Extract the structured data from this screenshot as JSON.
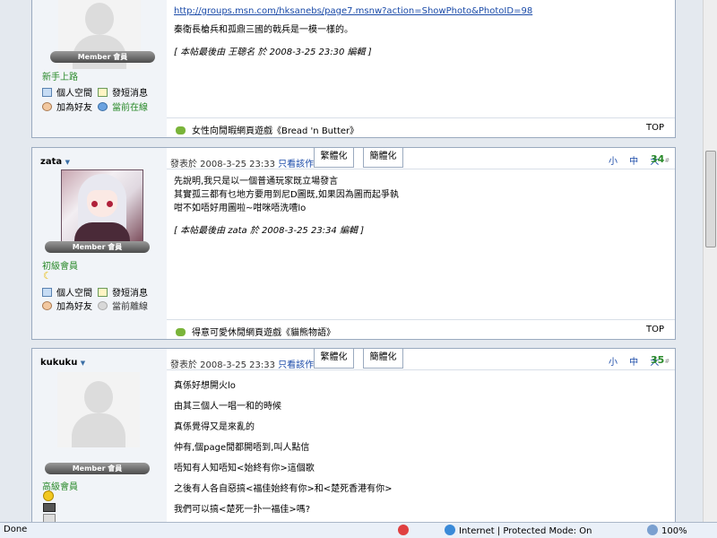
{
  "post1": {
    "link_url": "http://groups.msn.com/hksanebs/page7.msnw?action=ShowPhoto&PhotoID=98",
    "line2": "秦衛長槍兵和孤鼎三國的戟兵是一模一樣的。",
    "edit_note": "[ 本帖最後由 王聰名 於 2008-3-25 23:30 編輯 ]",
    "badge": "Member 會員",
    "rank": "新手上路",
    "links": [
      "個人空間",
      "發短消息",
      "加為好友",
      "當前在線"
    ],
    "ad": "女性向閒暇網頁遊戲《Bread 'n Butter》",
    "top": "TOP"
  },
  "post2": {
    "username": "zata",
    "badge": "Member 會員",
    "rank": "初級會員",
    "links": [
      "個人空間",
      "發短消息",
      "加為好友",
      "當前離線"
    ],
    "time": "發表於 2008-3-25 23:33",
    "only_author": "只看該作者",
    "btn_trad": "繁體化",
    "btn_simp": "簡體化",
    "sizes": "小 中 大",
    "floor": "34",
    "lines": [
      "先說明,我只是以一個普通玩家既立場發言",
      "其實孤三都有乜地方要用到尼D圖既,如果因為圖而起爭執",
      "咁不如唔好用圖啦~咁咪唔洗嘈lo"
    ],
    "edit_note": "[ 本帖最後由 zata 於 2008-3-25 23:34 編輯 ]",
    "ad": "得意可愛休閒網頁遊戲《貓熊物語》",
    "top": "TOP"
  },
  "post3": {
    "username": "kukuku",
    "badge": "Member 會員",
    "rank": "高級會員",
    "time": "發表於 2008-3-25 23:33",
    "only_author": "只看該作者",
    "btn_trad": "繁體化",
    "btn_simp": "簡體化",
    "sizes": "小 中 大",
    "floor": "35",
    "lines": [
      "真係好想開火lo",
      "由其三個人一唱一和的時候",
      "真係覺得又是來亂的",
      "仲有,個page閒都開唔到,叫人點信",
      "唔知有人知唔知<始終有你>這個歌",
      "之後有人各自惡搞<福佳始終有你>和<楚死香港有你>",
      "我們可以搞<楚死一扑一福佳>嗎?"
    ]
  },
  "statusbar": {
    "status": "Done",
    "zone": "Internet | Protected Mode: On",
    "zoom": "100%"
  }
}
